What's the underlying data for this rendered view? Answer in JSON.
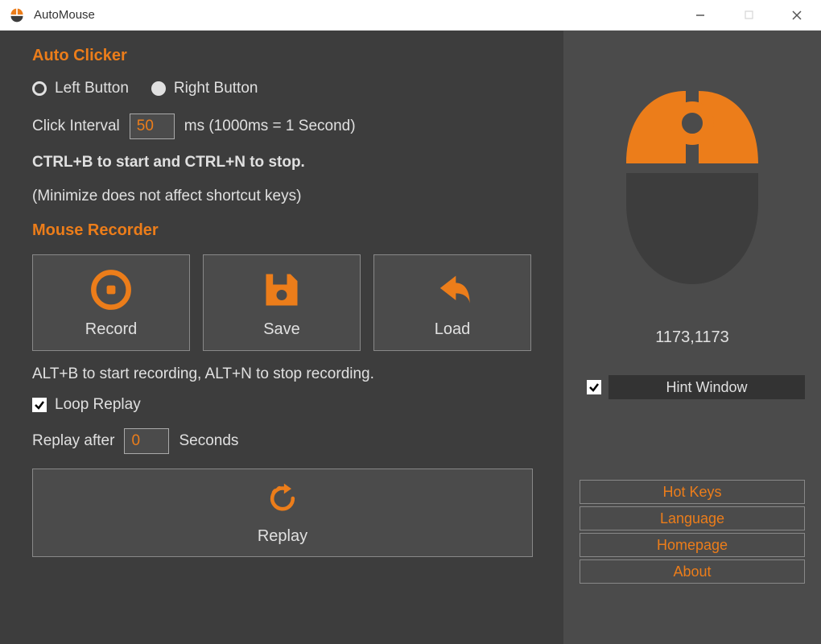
{
  "window": {
    "title": "AutoMouse"
  },
  "colors": {
    "accent": "#ec7d1a",
    "bg_dark": "#3d3d3d",
    "bg_panel": "#4b4b4b"
  },
  "auto_clicker": {
    "heading": "Auto Clicker",
    "left_button_label": "Left Button",
    "right_button_label": "Right Button",
    "selected": "left",
    "interval_label": "Click Interval",
    "interval_value": "50",
    "interval_unit": "ms (1000ms = 1 Second)",
    "hotkey_hint": "CTRL+B to start and CTRL+N to stop.",
    "minimize_hint": "(Minimize does not affect shortcut keys)"
  },
  "mouse_recorder": {
    "heading": "Mouse Recorder",
    "record_label": "Record",
    "save_label": "Save",
    "load_label": "Load",
    "hotkey_hint": "ALT+B to start recording, ALT+N to stop recording.",
    "loop_replay_label": "Loop Replay",
    "loop_replay_checked": true,
    "replay_after_label": "Replay after",
    "replay_after_value": "0",
    "replay_after_unit": "Seconds",
    "replay_label": "Replay"
  },
  "side": {
    "coords": "1173,1173",
    "hint_window_label": "Hint Window",
    "hint_window_checked": true,
    "links": {
      "hot_keys": "Hot Keys",
      "language": "Language",
      "homepage": "Homepage",
      "about": "About"
    }
  }
}
